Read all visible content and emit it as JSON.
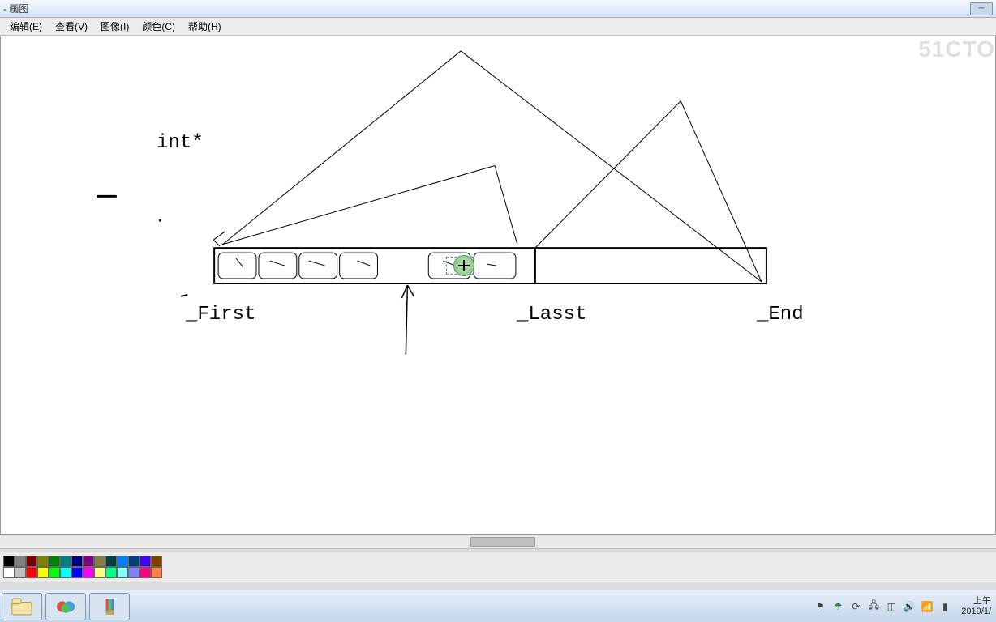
{
  "window": {
    "title": "- 画图"
  },
  "menu": {
    "edit": "编辑(E)",
    "view": "查看(V)",
    "image": "图像(I)",
    "color": "颜色(C)",
    "help": "帮助(H)"
  },
  "canvas": {
    "watermark": "51CTO",
    "text_intptr": "int*",
    "label_first": "_First",
    "label_lasst": "_Lasst",
    "label_end": "_End"
  },
  "palette_row1": [
    "#000000",
    "#808080",
    "#800000",
    "#808000",
    "#008000",
    "#008080",
    "#000080",
    "#800080",
    "#808040",
    "#004040",
    "#0080ff",
    "#004080",
    "#4000ff",
    "#804000"
  ],
  "palette_row2": [
    "#ffffff",
    "#c0c0c0",
    "#ff0000",
    "#ffff00",
    "#00ff00",
    "#00ffff",
    "#0000ff",
    "#ff00ff",
    "#ffff80",
    "#00ff80",
    "#80ffff",
    "#8080ff",
    "#ff0080",
    "#ff8040"
  ],
  "clock": {
    "period": "上午",
    "date": "2019/1/"
  }
}
